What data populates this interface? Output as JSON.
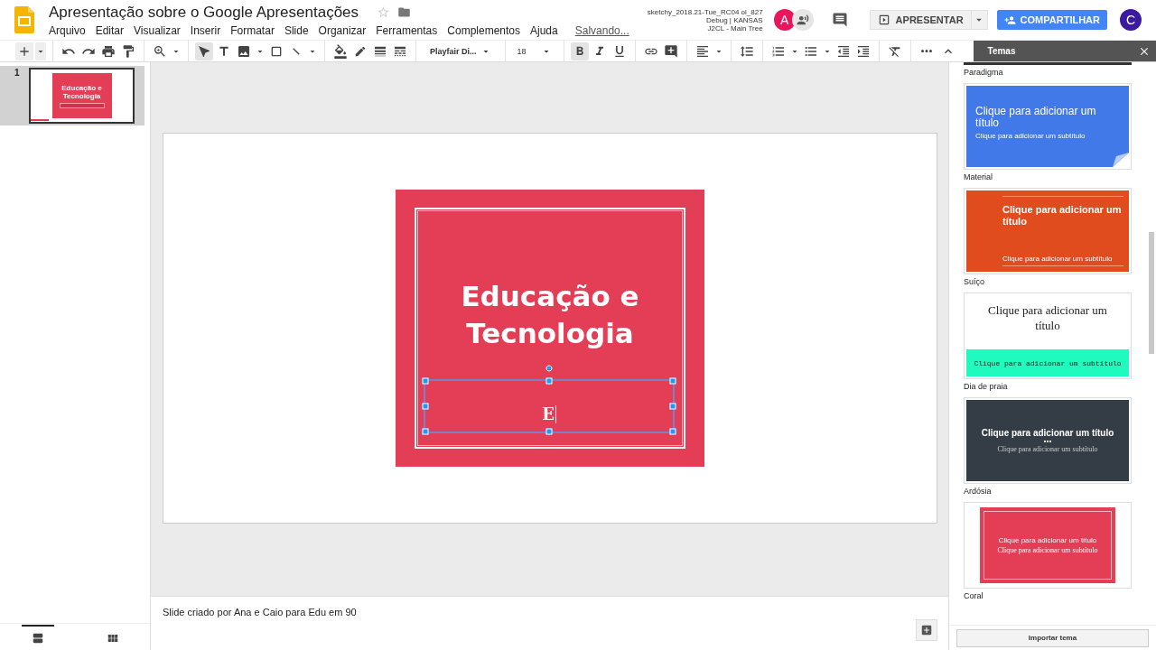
{
  "app": {
    "title": "Apresentação sobre o Google Apresentações",
    "starred": false,
    "menus": [
      "Arquivo",
      "Editar",
      "Visualizar",
      "Inserir",
      "Formatar",
      "Slide",
      "Organizar",
      "Ferramentas",
      "Complementos",
      "Ajuda"
    ],
    "save_status": "Salvando...",
    "build_info": [
      "sketchy_2018.21-Tue_RC04 oi_827",
      "Debug | KANSAS",
      "J2CL - Main Tree"
    ],
    "collaborators": [
      {
        "initial": "A",
        "color": "#e8175d"
      }
    ],
    "present_label": "APRESENTAR",
    "share_label": "COMPARTILHAR",
    "user_initial": "C"
  },
  "toolbar": {
    "font": "Playfair Di...",
    "font_size": "18",
    "bold": true,
    "italic": false,
    "underline": false
  },
  "filmstrip": [
    {
      "number": "1",
      "selected": true,
      "title": "Educação e Tecnologia"
    }
  ],
  "slide": {
    "title": "Educação e Tecnologia",
    "subtitle": "E"
  },
  "notes": "Slide criado por Ana e Caio para Edu em 90",
  "view_toggles": [
    {
      "kind": "list",
      "selected": true
    },
    {
      "kind": "grid",
      "selected": false
    }
  ],
  "themes_panel": {
    "title": "Temas",
    "import_label": "Importar tema",
    "themes": [
      {
        "kind": "cut",
        "name": "Paradigma"
      },
      {
        "kind": "material",
        "name": "Material",
        "preview_title": "Clique para adicionar um título",
        "preview_subtitle": "Clique para adicionar um subtítulo"
      },
      {
        "kind": "swiss",
        "name": "Suíço",
        "preview_title": "Clique para adicionar um título",
        "preview_subtitle": "Clique para adicionar um subtítulo"
      },
      {
        "kind": "beach",
        "name": "Dia de praia",
        "preview_title": "Clique para adicionar um título",
        "preview_subtitle": "Clique para adicionar um subtítulo"
      },
      {
        "kind": "slate",
        "name": "Ardósia",
        "preview_title": "Clique para adicionar um título",
        "preview_subtitle": "Clique para adicionar um subtítulo"
      },
      {
        "kind": "coral",
        "name": "Coral",
        "preview_title": "Clique para adicionar um título",
        "preview_subtitle": "Clique para adicionar um subtítulo"
      }
    ]
  }
}
